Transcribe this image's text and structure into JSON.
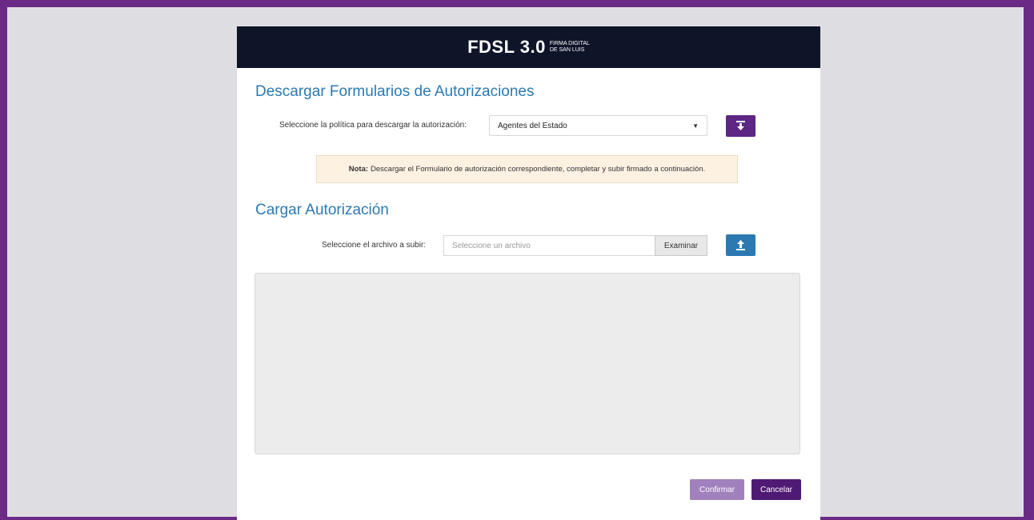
{
  "header": {
    "logo_main": "FDSL 3.0",
    "logo_sub_line1": "FIRMA DIGITAL",
    "logo_sub_line2": "DE SAN LUIS"
  },
  "download_section": {
    "title": "Descargar Formularios de Autorizaciones",
    "policy_label": "Seleccione la política para descargar la autorización:",
    "policy_selected": "Agentes del Estado",
    "download_icon": "download-icon",
    "note_bold": "Nota:",
    "note_text": "Descargar el Formulario de autorización correspondiente, completar y subir firmado a continuación."
  },
  "upload_section": {
    "title": "Cargar Autorización",
    "file_label": "Seleccione el archivo a subir:",
    "file_placeholder": "Seleccione un archivo",
    "browse_label": "Examinar",
    "upload_icon": "upload-icon"
  },
  "actions": {
    "confirm_label": "Confirmar",
    "cancel_label": "Cancelar"
  },
  "colors": {
    "frame": "#6a2a86",
    "header_bg": "#0f1529",
    "title_blue": "#2c79b2",
    "purple_button": "#5d2584",
    "confirm_button": "#a081bd",
    "cancel_button": "#4f1a74"
  }
}
